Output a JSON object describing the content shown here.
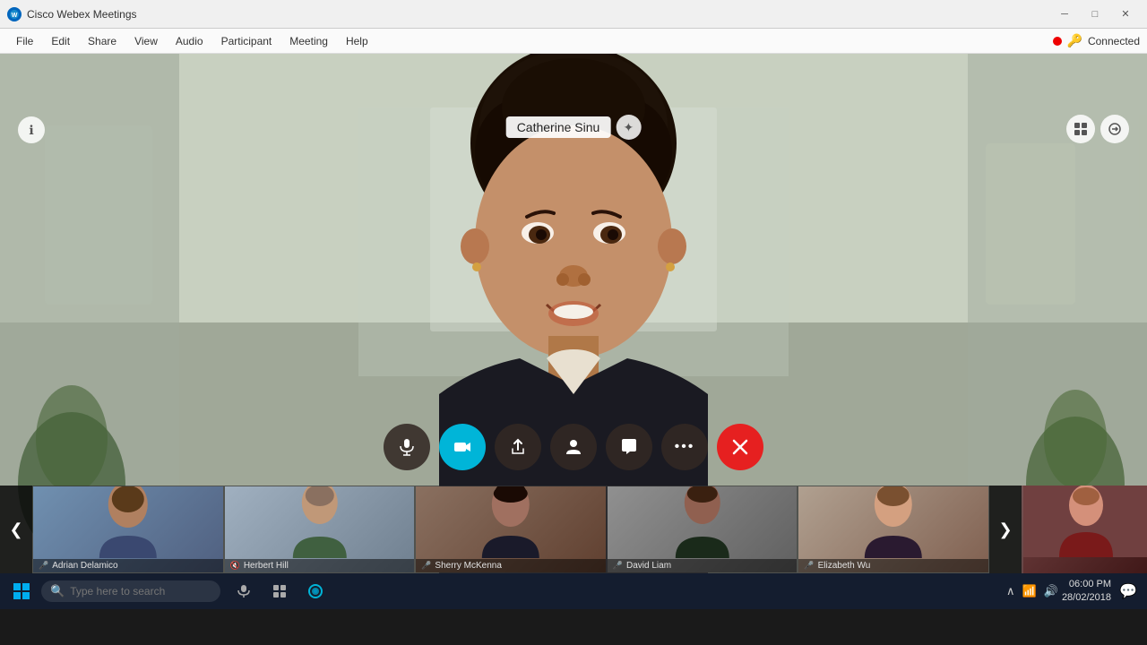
{
  "app": {
    "title": "Cisco Webex Meetings",
    "icon": "W"
  },
  "titlebar": {
    "minimize": "─",
    "maximize": "□",
    "close": "✕"
  },
  "menubar": {
    "items": [
      "File",
      "Edit",
      "Share",
      "View",
      "Audio",
      "Participant",
      "Meeting",
      "Help"
    ],
    "status_dot_color": "#cc0000",
    "status_label": "Connected"
  },
  "main_video": {
    "speaker_name": "Catherine Sinu",
    "info_btn_icon": "ℹ",
    "pin_icon": "✦",
    "layout_icon": "⊞",
    "swap_icon": "⇌"
  },
  "controls": [
    {
      "id": "mic",
      "icon": "🎤",
      "style": "dark",
      "label": "Mute"
    },
    {
      "id": "video",
      "icon": "📷",
      "style": "cyan",
      "label": "Video"
    },
    {
      "id": "share",
      "icon": "↑",
      "style": "dark",
      "label": "Share"
    },
    {
      "id": "participants",
      "icon": "👤",
      "style": "dark",
      "label": "Participants"
    },
    {
      "id": "chat",
      "icon": "💬",
      "style": "dark",
      "label": "Chat"
    },
    {
      "id": "more",
      "icon": "•••",
      "style": "dark",
      "label": "More"
    },
    {
      "id": "end",
      "icon": "✕",
      "style": "red",
      "label": "End"
    }
  ],
  "participants": [
    {
      "name": "Adrian Delamico",
      "mic": "on",
      "thumb": "thumb-1",
      "head_color": "#b08060",
      "body_color": "#3a4870"
    },
    {
      "name": "Herbert Hill",
      "mic": "muted",
      "thumb": "thumb-2",
      "head_color": "#c09878",
      "body_color": "#406040"
    },
    {
      "name": "Sherry McKenna",
      "mic": "on",
      "thumb": "thumb-3",
      "head_color": "#a07060",
      "body_color": "#1a1a2a"
    },
    {
      "name": "David Liam",
      "mic": "on",
      "thumb": "thumb-4",
      "head_color": "#906050",
      "body_color": "#1a2a1a"
    },
    {
      "name": "Elizabeth Wu",
      "mic": "on",
      "thumb": "thumb-5",
      "head_color": "#d4a080",
      "body_color": "#2a1a30"
    }
  ],
  "nav": {
    "prev_icon": "❮",
    "next_icon": "❯"
  },
  "taskbar": {
    "search_placeholder": "Type here to search",
    "mic_icon": "🎤",
    "time": "06:00 PM",
    "date": "28/02/2018"
  }
}
